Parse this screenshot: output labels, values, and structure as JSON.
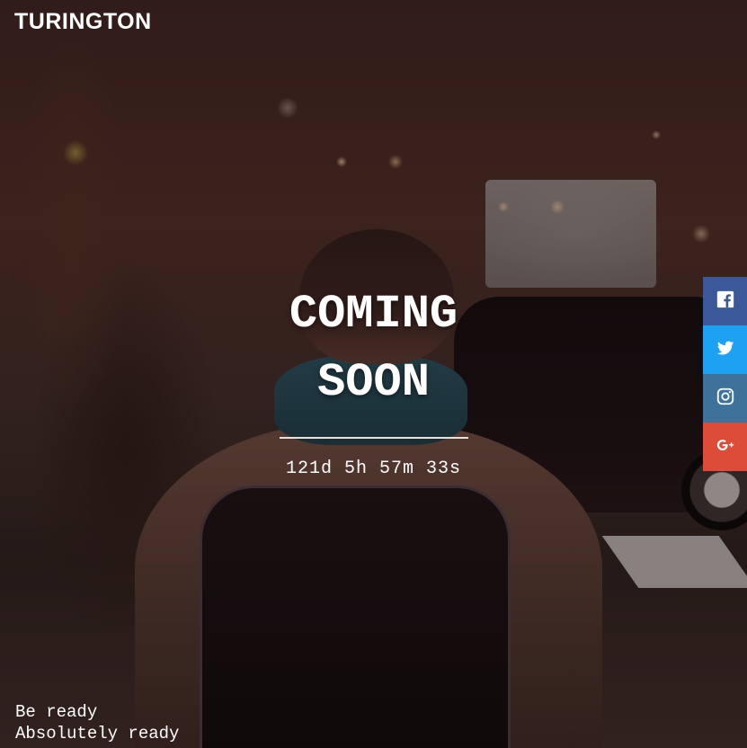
{
  "brand": {
    "name": "TURINGTON"
  },
  "hero": {
    "heading_line1": "COMING",
    "heading_line2": "SOON",
    "countdown": "121d 5h 57m 33s"
  },
  "social": {
    "items": [
      {
        "name": "facebook",
        "icon": "facebook-icon",
        "color": "#3b5998"
      },
      {
        "name": "twitter",
        "icon": "twitter-icon",
        "color": "#1da1f2"
      },
      {
        "name": "instagram",
        "icon": "instagram-icon",
        "color": "#3f729b"
      },
      {
        "name": "google-plus",
        "icon": "google-plus-icon",
        "color": "#dd4b39"
      }
    ]
  },
  "footer": {
    "line1": "Be ready",
    "line2": "Absolutely ready"
  }
}
